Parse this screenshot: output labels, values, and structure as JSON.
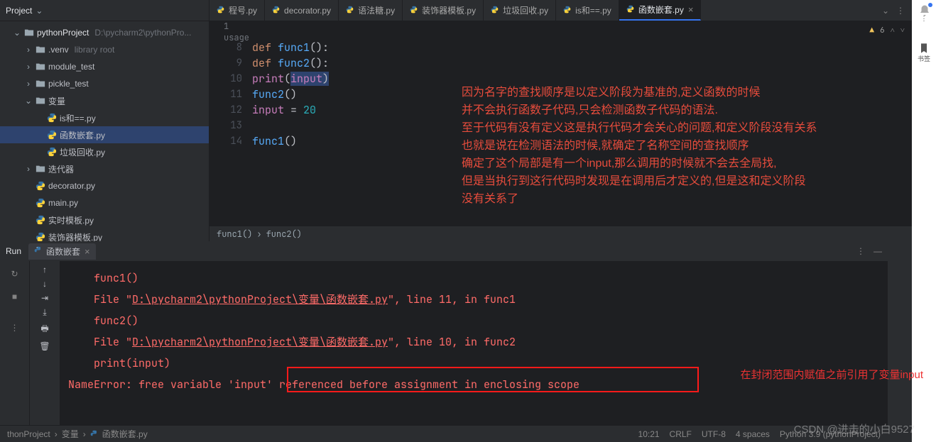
{
  "project": {
    "title": "Project",
    "root_label": "pythonProject",
    "root_path": "D:\\pycharm2\\pythonPro..."
  },
  "tree": [
    {
      "type": "folder",
      "label": ".venv",
      "hint": "library root",
      "indent": 1,
      "chev": "right"
    },
    {
      "type": "folder",
      "label": "module_test",
      "indent": 1,
      "chev": "right"
    },
    {
      "type": "folder",
      "label": "pickle_test",
      "indent": 1,
      "chev": "right"
    },
    {
      "type": "folder",
      "label": "变量",
      "indent": 1,
      "chev": "down"
    },
    {
      "type": "py",
      "label": "is和==.py",
      "indent": 2
    },
    {
      "type": "py",
      "label": "函数嵌套.py",
      "indent": 2,
      "selected": true
    },
    {
      "type": "py",
      "label": "垃圾回收.py",
      "indent": 2
    },
    {
      "type": "folder",
      "label": "迭代器",
      "indent": 1,
      "chev": "right"
    },
    {
      "type": "py",
      "label": "decorator.py",
      "indent": 1
    },
    {
      "type": "py",
      "label": "main.py",
      "indent": 1
    },
    {
      "type": "py",
      "label": "实时模板.py",
      "indent": 1
    },
    {
      "type": "py",
      "label": "装饰器模板.py",
      "indent": 1
    }
  ],
  "tabs": [
    "程号.py",
    "decorator.py",
    "语法糖.py",
    "装饰器模板.py",
    "垃圾回收.py",
    "is和==.py",
    "函数嵌套.py"
  ],
  "active_tab": 6,
  "usage": "1 usage",
  "lines": {
    "numbers": [
      "8",
      "9",
      "10",
      "11",
      "12",
      "13",
      "14"
    ]
  },
  "warn": {
    "count": "6"
  },
  "crumbs": [
    "func1()",
    "func2()"
  ],
  "annotation": [
    "因为名字的查找顺序是以定义阶段为基准的,定义函数的时候",
    "并不会执行函数子代码,只会检测函数子代码的语法.",
    "至于代码有没有定义这是执行代码才会关心的问题,和定义阶段没有关系",
    "也就是说在检测语法的时候,就确定了名称空间的查找顺序",
    "确定了这个局部是有一个input,那么调用的时候就不会去全局找,",
    "但是当执行到这行代码时发现是在调用后才定义的,但是这和定义阶段",
    "没有关系了"
  ],
  "annotation2": "在封闭范围内赋值之前引用了变量input",
  "run": {
    "label": "Run",
    "tab": "函数嵌套",
    "lines": [
      {
        "indent": 2,
        "text": "func1()"
      },
      {
        "indent": 1,
        "prefix": "  File \"",
        "link": "D:\\pycharm2\\pythonProject\\变量\\函数嵌套.py",
        "suffix": "\", line 11, in func1"
      },
      {
        "indent": 2,
        "text": "func2()"
      },
      {
        "indent": 1,
        "prefix": "  File \"",
        "link": "D:\\pycharm2\\pythonProject\\变量\\函数嵌套.py",
        "suffix": "\", line 10, in func2"
      },
      {
        "indent": 2,
        "text": "print(input)"
      },
      {
        "indent": 0,
        "text": "NameError: free variable 'input' referenced before assignment in enclosing scope"
      }
    ]
  },
  "status": {
    "path": [
      "thonProject",
      "变量",
      "函数嵌套.py"
    ],
    "pos": "10:21",
    "sep": "CRLF",
    "enc": "UTF-8",
    "indent": "4 spaces",
    "interp": "Python 3.9 (pythonProject)"
  },
  "watermark": "CSDN @进击的小白9527",
  "far_right": [
    "⋮",
    "书签"
  ]
}
